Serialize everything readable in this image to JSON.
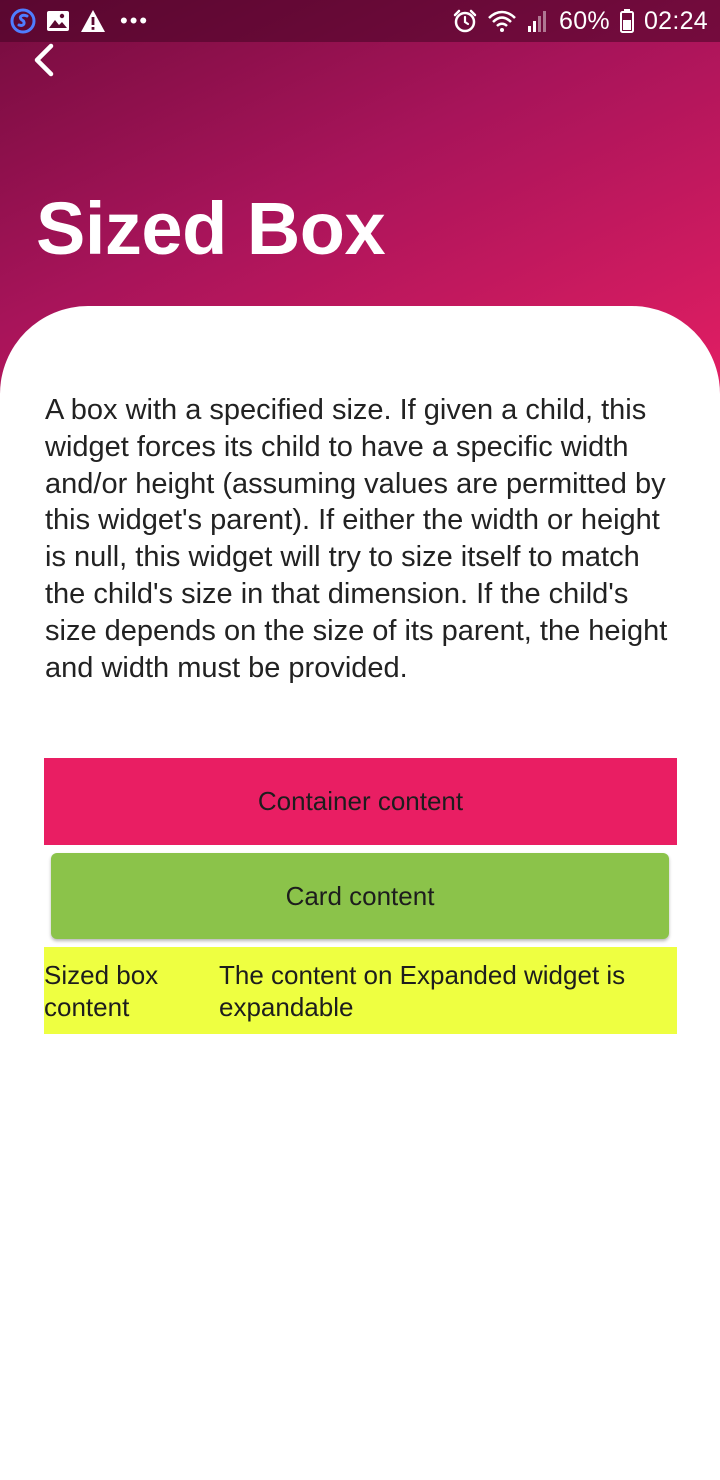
{
  "status_bar": {
    "battery_percent": "60%",
    "time": "02:24",
    "icons": [
      "s-app-icon",
      "image-icon",
      "warning-icon",
      "more-dots-icon",
      "alarm-icon",
      "wifi-icon",
      "signal-icon",
      "battery-icon"
    ]
  },
  "header": {
    "title": "Sized Box",
    "gradient_start": "#740c3e",
    "gradient_end": "#e31e63"
  },
  "content": {
    "description": "A box with a specified size. If given a child, this widget forces its child to have a specific width and/or height (assuming values are permitted by this widget's parent). If either the width or height is null, this widget will try to size itself to match the child's size in that dimension. If the child's size depends on the size of its parent, the height and width must be provided.",
    "container_label": "Container content",
    "container_color": "#e91e63",
    "card_label": "Card content",
    "card_color": "#8bc34a",
    "sized_box_label": "Sized box content",
    "expanded_label": "The content on Expanded widget is expandable",
    "row_color": "#eeff41"
  }
}
